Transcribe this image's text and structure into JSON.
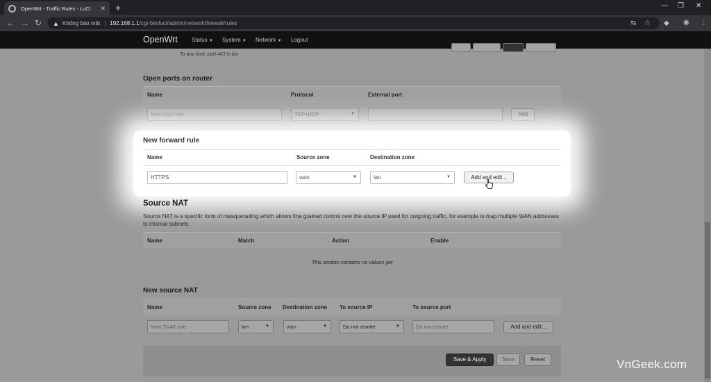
{
  "browser": {
    "tab_title": "OpenWrt - Traffic Rules - LuCI",
    "insecure_label": "Không bảo mật",
    "url_host": "192.168.1.1",
    "url_path": "/cgi-bin/luci/admin/network/firewall/rules"
  },
  "header": {
    "brand": "OpenWrt",
    "nav": [
      "Status",
      "System",
      "Network",
      "Logout"
    ]
  },
  "prev_rule_desc": "To any host, port 443 in lan",
  "open_ports": {
    "title": "Open ports on router",
    "columns": [
      "Name",
      "Protocol",
      "External port"
    ],
    "name_placeholder": "New input rule",
    "protocol": "TCP+UDP",
    "add_label": "Add"
  },
  "forward_rule": {
    "title": "New forward rule",
    "columns": [
      "Name",
      "Source zone",
      "Destination zone"
    ],
    "name_value": "HTTPS",
    "source_zone": "wan",
    "dest_zone": "lan",
    "add_edit_label": "Add and edit..."
  },
  "source_nat": {
    "title": "Source NAT",
    "description": "Source NAT is a specific form of masquerading which allows fine grained control over the source IP used for outgoing traffic, for example to map multiple WAN addresses to internal subnets.",
    "columns": [
      "Name",
      "Match",
      "Action",
      "Enable"
    ],
    "empty_message": "This section contains no values yet"
  },
  "new_source_nat": {
    "title": "New source NAT",
    "columns": [
      "Name",
      "Source zone",
      "Destination zone",
      "To source IP",
      "To source port"
    ],
    "name_placeholder": "New SNAT rule",
    "source_zone": "lan",
    "dest_zone": "wan",
    "to_source_ip": "Do not rewrite",
    "to_source_port_placeholder": "Do not rewrite",
    "add_edit_label": "Add and edit..."
  },
  "footer": {
    "save_apply": "Save & Apply",
    "save": "Save",
    "reset": "Reset"
  },
  "watermark": "VnGeek.com"
}
